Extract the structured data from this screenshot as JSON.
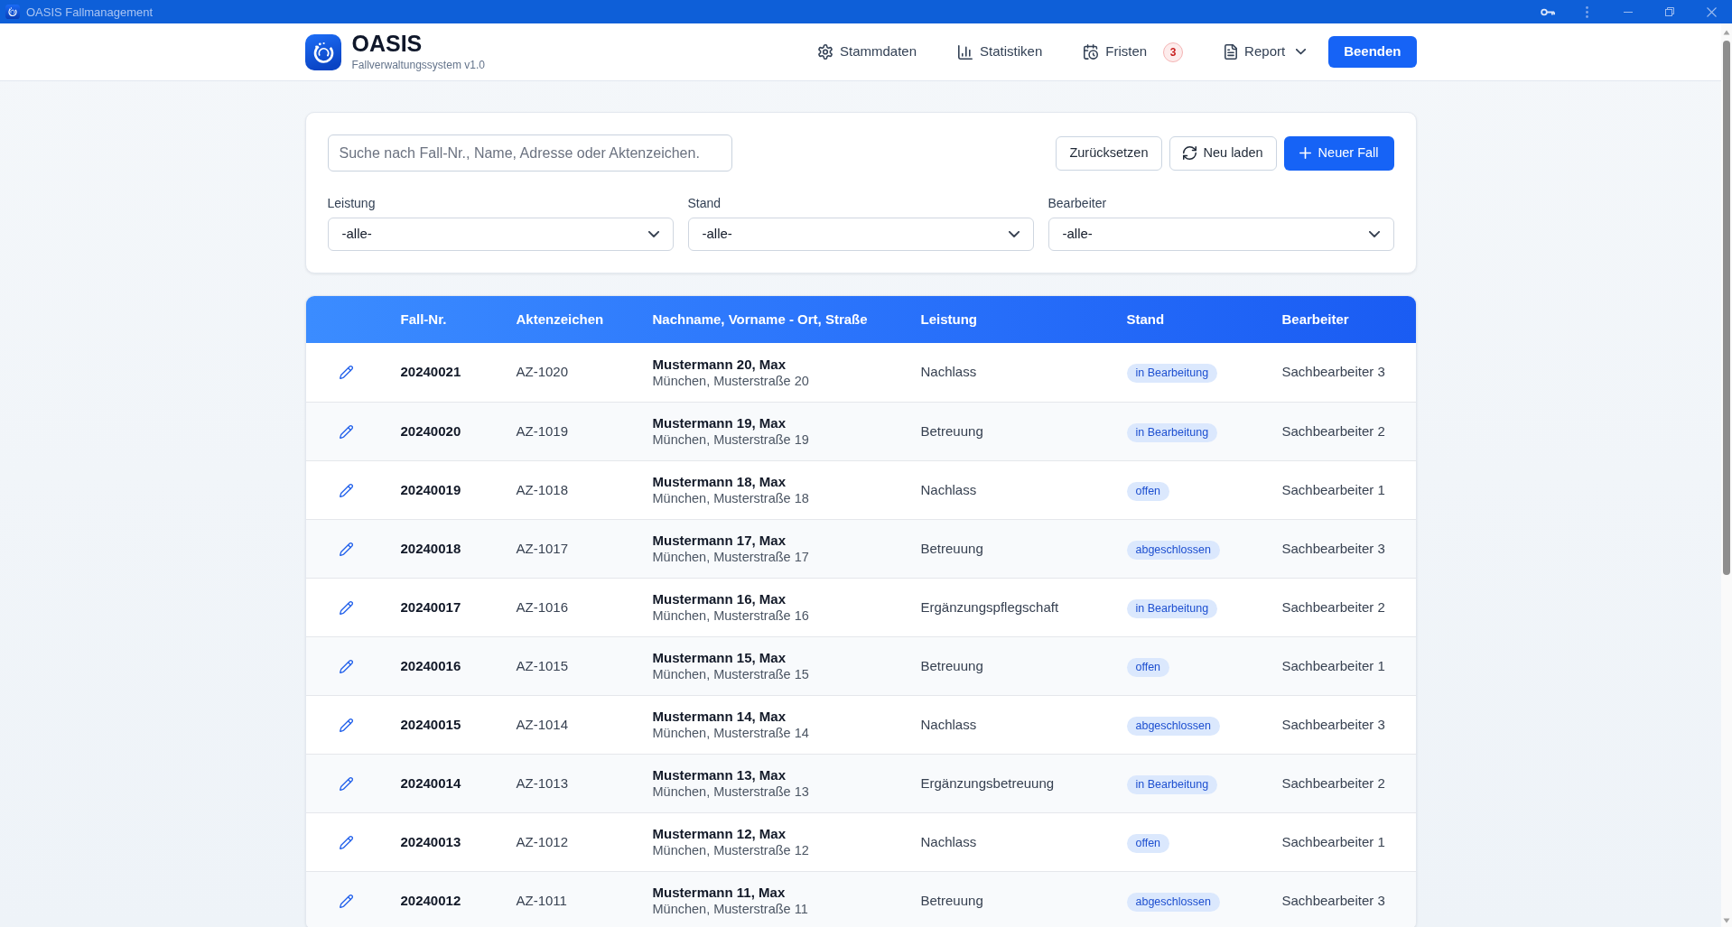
{
  "window": {
    "title": "OASIS Fallmanagement"
  },
  "header": {
    "app_name": "OASIS",
    "subtitle": "Fallverwaltungssystem v1.0",
    "nav": [
      {
        "kind": "link",
        "label": "Stammdaten"
      },
      {
        "kind": "link",
        "label": "Statistiken"
      },
      {
        "kind": "link",
        "label": "Fristen",
        "badge": "3"
      },
      {
        "kind": "dropdown",
        "label": "Report"
      }
    ],
    "exit_button": {
      "label": "Beenden"
    }
  },
  "filters": {
    "search": {
      "placeholder": "Suche nach Fall-Nr., Name, Adresse oder Aktenzeichen."
    },
    "buttons": [
      {
        "kind": "outline",
        "label": "Zurücksetzen"
      },
      {
        "kind": "outline",
        "label": "Neu laden"
      },
      {
        "kind": "primary",
        "label": "Neuer Fall"
      }
    ],
    "selects": [
      {
        "label": "Leistung",
        "value": "-alle-"
      },
      {
        "label": "Stand",
        "value": "-alle-"
      },
      {
        "label": "Bearbeiter",
        "value": "-alle-"
      }
    ]
  },
  "table": {
    "columns": [
      "Fall-Nr.",
      "Aktenzeichen",
      "Nachname, Vorname - Ort, Straße",
      "Leistung",
      "Stand",
      "Bearbeiter"
    ],
    "rows": [
      {
        "case_number": "20240021",
        "file_reference": "AZ-1020",
        "name": "Mustermann 20, Max",
        "address": "München, Musterstraße 20",
        "service": "Nachlass",
        "status": "in Bearbeitung",
        "assignee": "Sachbearbeiter 3"
      },
      {
        "case_number": "20240020",
        "file_reference": "AZ-1019",
        "name": "Mustermann 19, Max",
        "address": "München, Musterstraße 19",
        "service": "Betreuung",
        "status": "in Bearbeitung",
        "assignee": "Sachbearbeiter 2"
      },
      {
        "case_number": "20240019",
        "file_reference": "AZ-1018",
        "name": "Mustermann 18, Max",
        "address": "München, Musterstraße 18",
        "service": "Nachlass",
        "status": "offen",
        "assignee": "Sachbearbeiter 1"
      },
      {
        "case_number": "20240018",
        "file_reference": "AZ-1017",
        "name": "Mustermann 17, Max",
        "address": "München, Musterstraße 17",
        "service": "Betreuung",
        "status": "abgeschlossen",
        "assignee": "Sachbearbeiter 3"
      },
      {
        "case_number": "20240017",
        "file_reference": "AZ-1016",
        "name": "Mustermann 16, Max",
        "address": "München, Musterstraße 16",
        "service": "Ergänzungspflegschaft",
        "status": "in Bearbeitung",
        "assignee": "Sachbearbeiter 2"
      },
      {
        "case_number": "20240016",
        "file_reference": "AZ-1015",
        "name": "Mustermann 15, Max",
        "address": "München, Musterstraße 15",
        "service": "Betreuung",
        "status": "offen",
        "assignee": "Sachbearbeiter 1"
      },
      {
        "case_number": "20240015",
        "file_reference": "AZ-1014",
        "name": "Mustermann 14, Max",
        "address": "München, Musterstraße 14",
        "service": "Nachlass",
        "status": "abgeschlossen",
        "assignee": "Sachbearbeiter 3"
      },
      {
        "case_number": "20240014",
        "file_reference": "AZ-1013",
        "name": "Mustermann 13, Max",
        "address": "München, Musterstraße 13",
        "service": "Ergänzungsbetreuung",
        "status": "in Bearbeitung",
        "assignee": "Sachbearbeiter 2"
      },
      {
        "case_number": "20240013",
        "file_reference": "AZ-1012",
        "name": "Mustermann 12, Max",
        "address": "München, Musterstraße 12",
        "service": "Nachlass",
        "status": "offen",
        "assignee": "Sachbearbeiter 1"
      },
      {
        "case_number": "20240012",
        "file_reference": "AZ-1011",
        "name": "Mustermann 11, Max",
        "address": "München, Musterstraße 11",
        "service": "Betreuung",
        "status": "abgeschlossen",
        "assignee": "Sachbearbeiter 3"
      }
    ]
  }
}
